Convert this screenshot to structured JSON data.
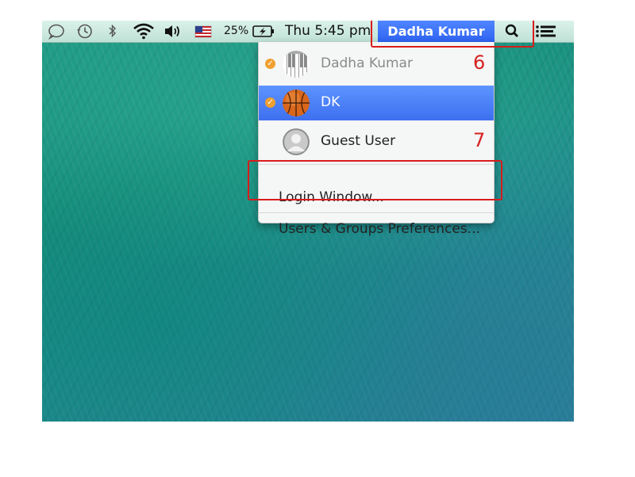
{
  "menubar": {
    "battery_percent": "25%",
    "clock": "Thu 5:45 pm",
    "active_user": "Dadha Kumar",
    "icons": [
      "messages-icon",
      "time-machine-icon",
      "bluetooth-icon",
      "wifi-icon",
      "volume-icon",
      "us-flag-icon",
      "battery-charging-icon",
      "spotlight-search-icon",
      "notification-center-icon"
    ]
  },
  "dropdown": {
    "users": [
      {
        "name": "Dadha Kumar",
        "avatar": "piano-avatar",
        "checked": true,
        "selected": false
      },
      {
        "name": "DK",
        "avatar": "basketball-avatar",
        "checked": true,
        "selected": true
      },
      {
        "name": "Guest User",
        "avatar": "guest-silhouette-avatar",
        "checked": false,
        "selected": false
      }
    ],
    "login_window": "Login Window...",
    "preferences": "Users & Groups Preferences..."
  },
  "annotations": {
    "step_6": "6",
    "step_7": "7",
    "color": "#d91c1c"
  },
  "colors": {
    "menu_highlight": "#3d6ff0",
    "check_badge": "#f0a030"
  }
}
